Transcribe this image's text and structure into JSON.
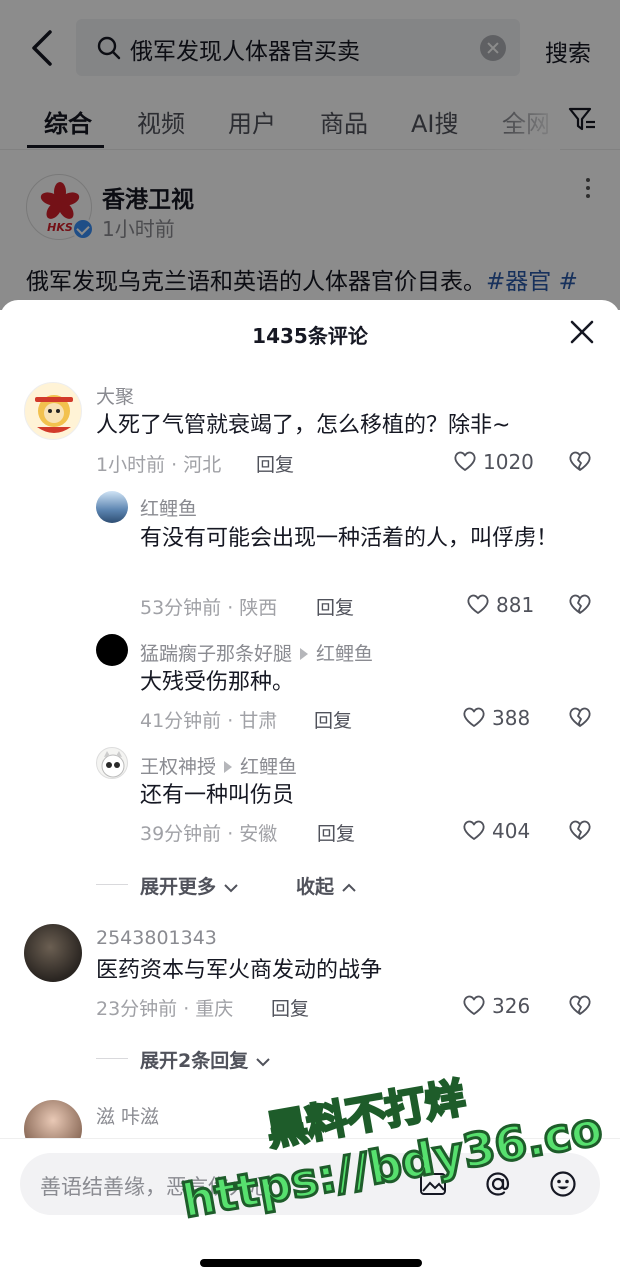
{
  "search": {
    "query": "俄军发现人体器官买卖",
    "button": "搜索"
  },
  "tabs": [
    "综合",
    "视频",
    "用户",
    "商品",
    "AI搜",
    "全网"
  ],
  "post": {
    "author": "香港卫视",
    "avatar_text": "HKS",
    "time": "1小时前",
    "text": "俄军发现乌克兰语和英语的人体器官价目表。",
    "tags": "#器官 #"
  },
  "sheet": {
    "title": "1435条评论"
  },
  "comments": [
    {
      "user": "大聚",
      "text": "人死了气管就衰竭了，怎么移植的？除非~",
      "meta": "1小时前 · 河北",
      "reply": "回复",
      "likes": "1020"
    },
    {
      "user": "红鲤鱼",
      "text": "有没有可能会出现一种活着的人，叫俘虏！",
      "meta": "53分钟前 · 陕西",
      "reply": "回复",
      "likes": "881"
    },
    {
      "user": "猛踹瘸子那条好腿",
      "reply_to": "红鲤鱼",
      "text": "大残受伤那种。",
      "meta": "41分钟前 · 甘肃",
      "reply": "回复",
      "likes": "388"
    },
    {
      "user": "王权神授",
      "reply_to": "红鲤鱼",
      "text": "还有一种叫伤员",
      "meta": "39分钟前 · 安徽",
      "reply": "回复",
      "likes": "404"
    },
    {
      "user": "2543801343",
      "text": "医药资本与军火商发动的战争",
      "meta": "23分钟前 · 重庆",
      "reply": "回复",
      "likes": "326"
    },
    {
      "user": "滋 咔滋"
    }
  ],
  "thread": {
    "expand_more": "展开更多",
    "collapse": "收起",
    "expand_two": "展开2条回复"
  },
  "input": {
    "placeholder": "善语结善缘，恶言伤人心"
  },
  "watermark": {
    "line1": "黑料不打烊",
    "line2": "https://bdy36.co"
  },
  "colors": {
    "accent_link": "#2b5aa8",
    "watermark_fill": "#57e06e",
    "watermark_stroke": "#1e5c2a"
  }
}
